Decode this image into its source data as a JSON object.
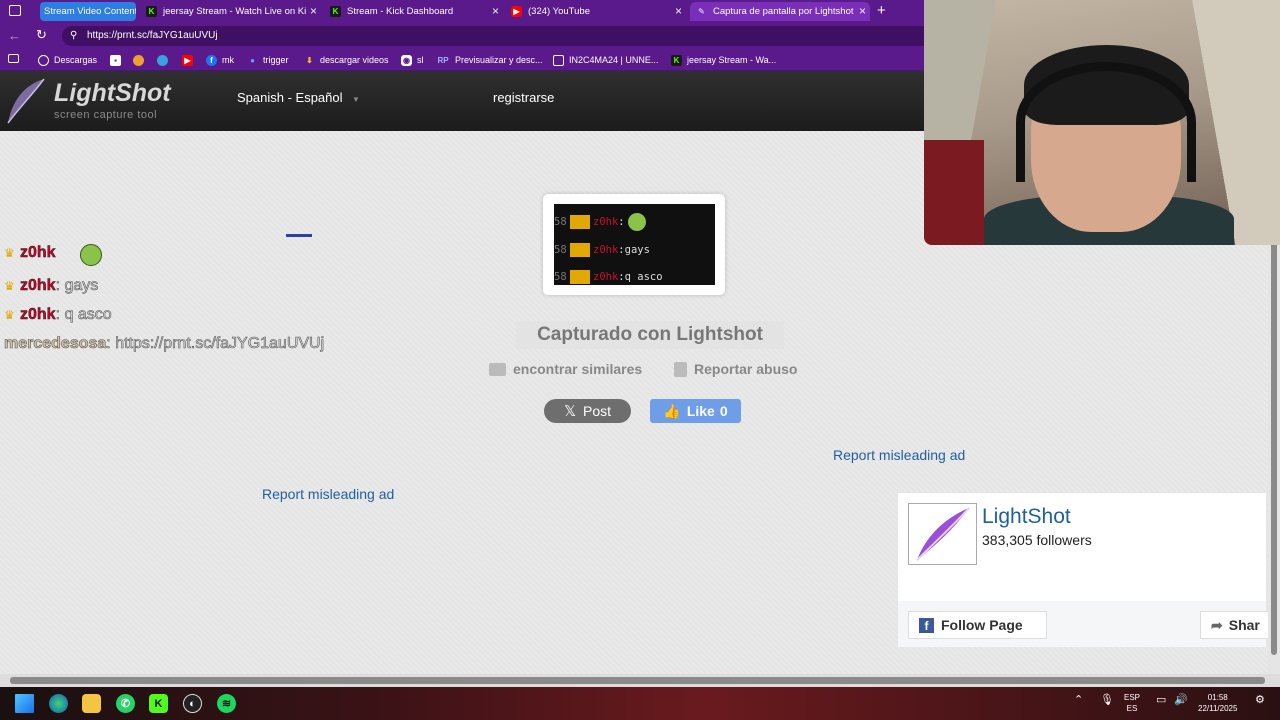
{
  "browser": {
    "tabs": [
      {
        "label": "Stream Video Content",
        "icon": "stream-group-label"
      },
      {
        "label": "jeersay Stream - Watch Live on Ki",
        "icon": "kick-icon"
      },
      {
        "label": "Stream - Kick Dashboard",
        "icon": "kick-icon"
      },
      {
        "label": "(324) YouTube",
        "icon": "youtube-icon"
      },
      {
        "label": "Captura de pantalla por Lightshot",
        "icon": "lightshot-icon",
        "active": true
      }
    ],
    "url": "https://prnt.sc/faJYG1auUVUj",
    "bookmarks": [
      {
        "label": "Descargas"
      },
      {
        "label": ""
      },
      {
        "label": ""
      },
      {
        "label": ""
      },
      {
        "label": ""
      },
      {
        "label": "mk"
      },
      {
        "label": "trigger"
      },
      {
        "label": "descargar videos"
      },
      {
        "label": "sl"
      },
      {
        "label": "Previsualizar y desc..."
      },
      {
        "label": "IN2C4MA24 | UNNE..."
      },
      {
        "label": "jeersay Stream - Wa..."
      }
    ]
  },
  "lightshot": {
    "logo_title": "LightShot",
    "logo_subtitle": "screen capture tool",
    "language": "Spanish - Español",
    "register": "registrarse",
    "captured_label": "Capturado con Lightshot",
    "find_similar": "encontrar similares",
    "report_abuse": "Reportar abuso",
    "post_button": "Post",
    "like_button": "Like",
    "like_count": "0",
    "report_ad_1": "Report misleading ad",
    "report_ad_2": "Report misleading ad"
  },
  "chat_overlay": [
    {
      "nick": "z0hk",
      "message": ""
    },
    {
      "nick": "z0hk",
      "message": ": gays"
    },
    {
      "nick": "z0hk",
      "message": ": q asco"
    },
    {
      "nick": "mercedesosa",
      "message": ": https://prnt.sc/faJYG1auUVUj"
    }
  ],
  "screenshot": {
    "lines": [
      {
        "num": "58",
        "nick": "z0hk",
        "msg": ":"
      },
      {
        "num": "58",
        "nick": "z0hk",
        "msg": ":gays"
      },
      {
        "num": "58",
        "nick": "z0hk",
        "msg": ":q asco"
      }
    ]
  },
  "facebook": {
    "page_name": "LightShot",
    "followers": "383,305 followers",
    "follow_button": "Follow Page",
    "share_button": "Shar"
  },
  "taskbar": {
    "language": "ESP",
    "language_sub": "ES",
    "time": "01:58",
    "date": "22/11/2025"
  },
  "colors": {
    "browser_chrome": "#5b1a8c",
    "lightshot_link": "#1f5f9e",
    "like_button": "#6f9ee8"
  }
}
